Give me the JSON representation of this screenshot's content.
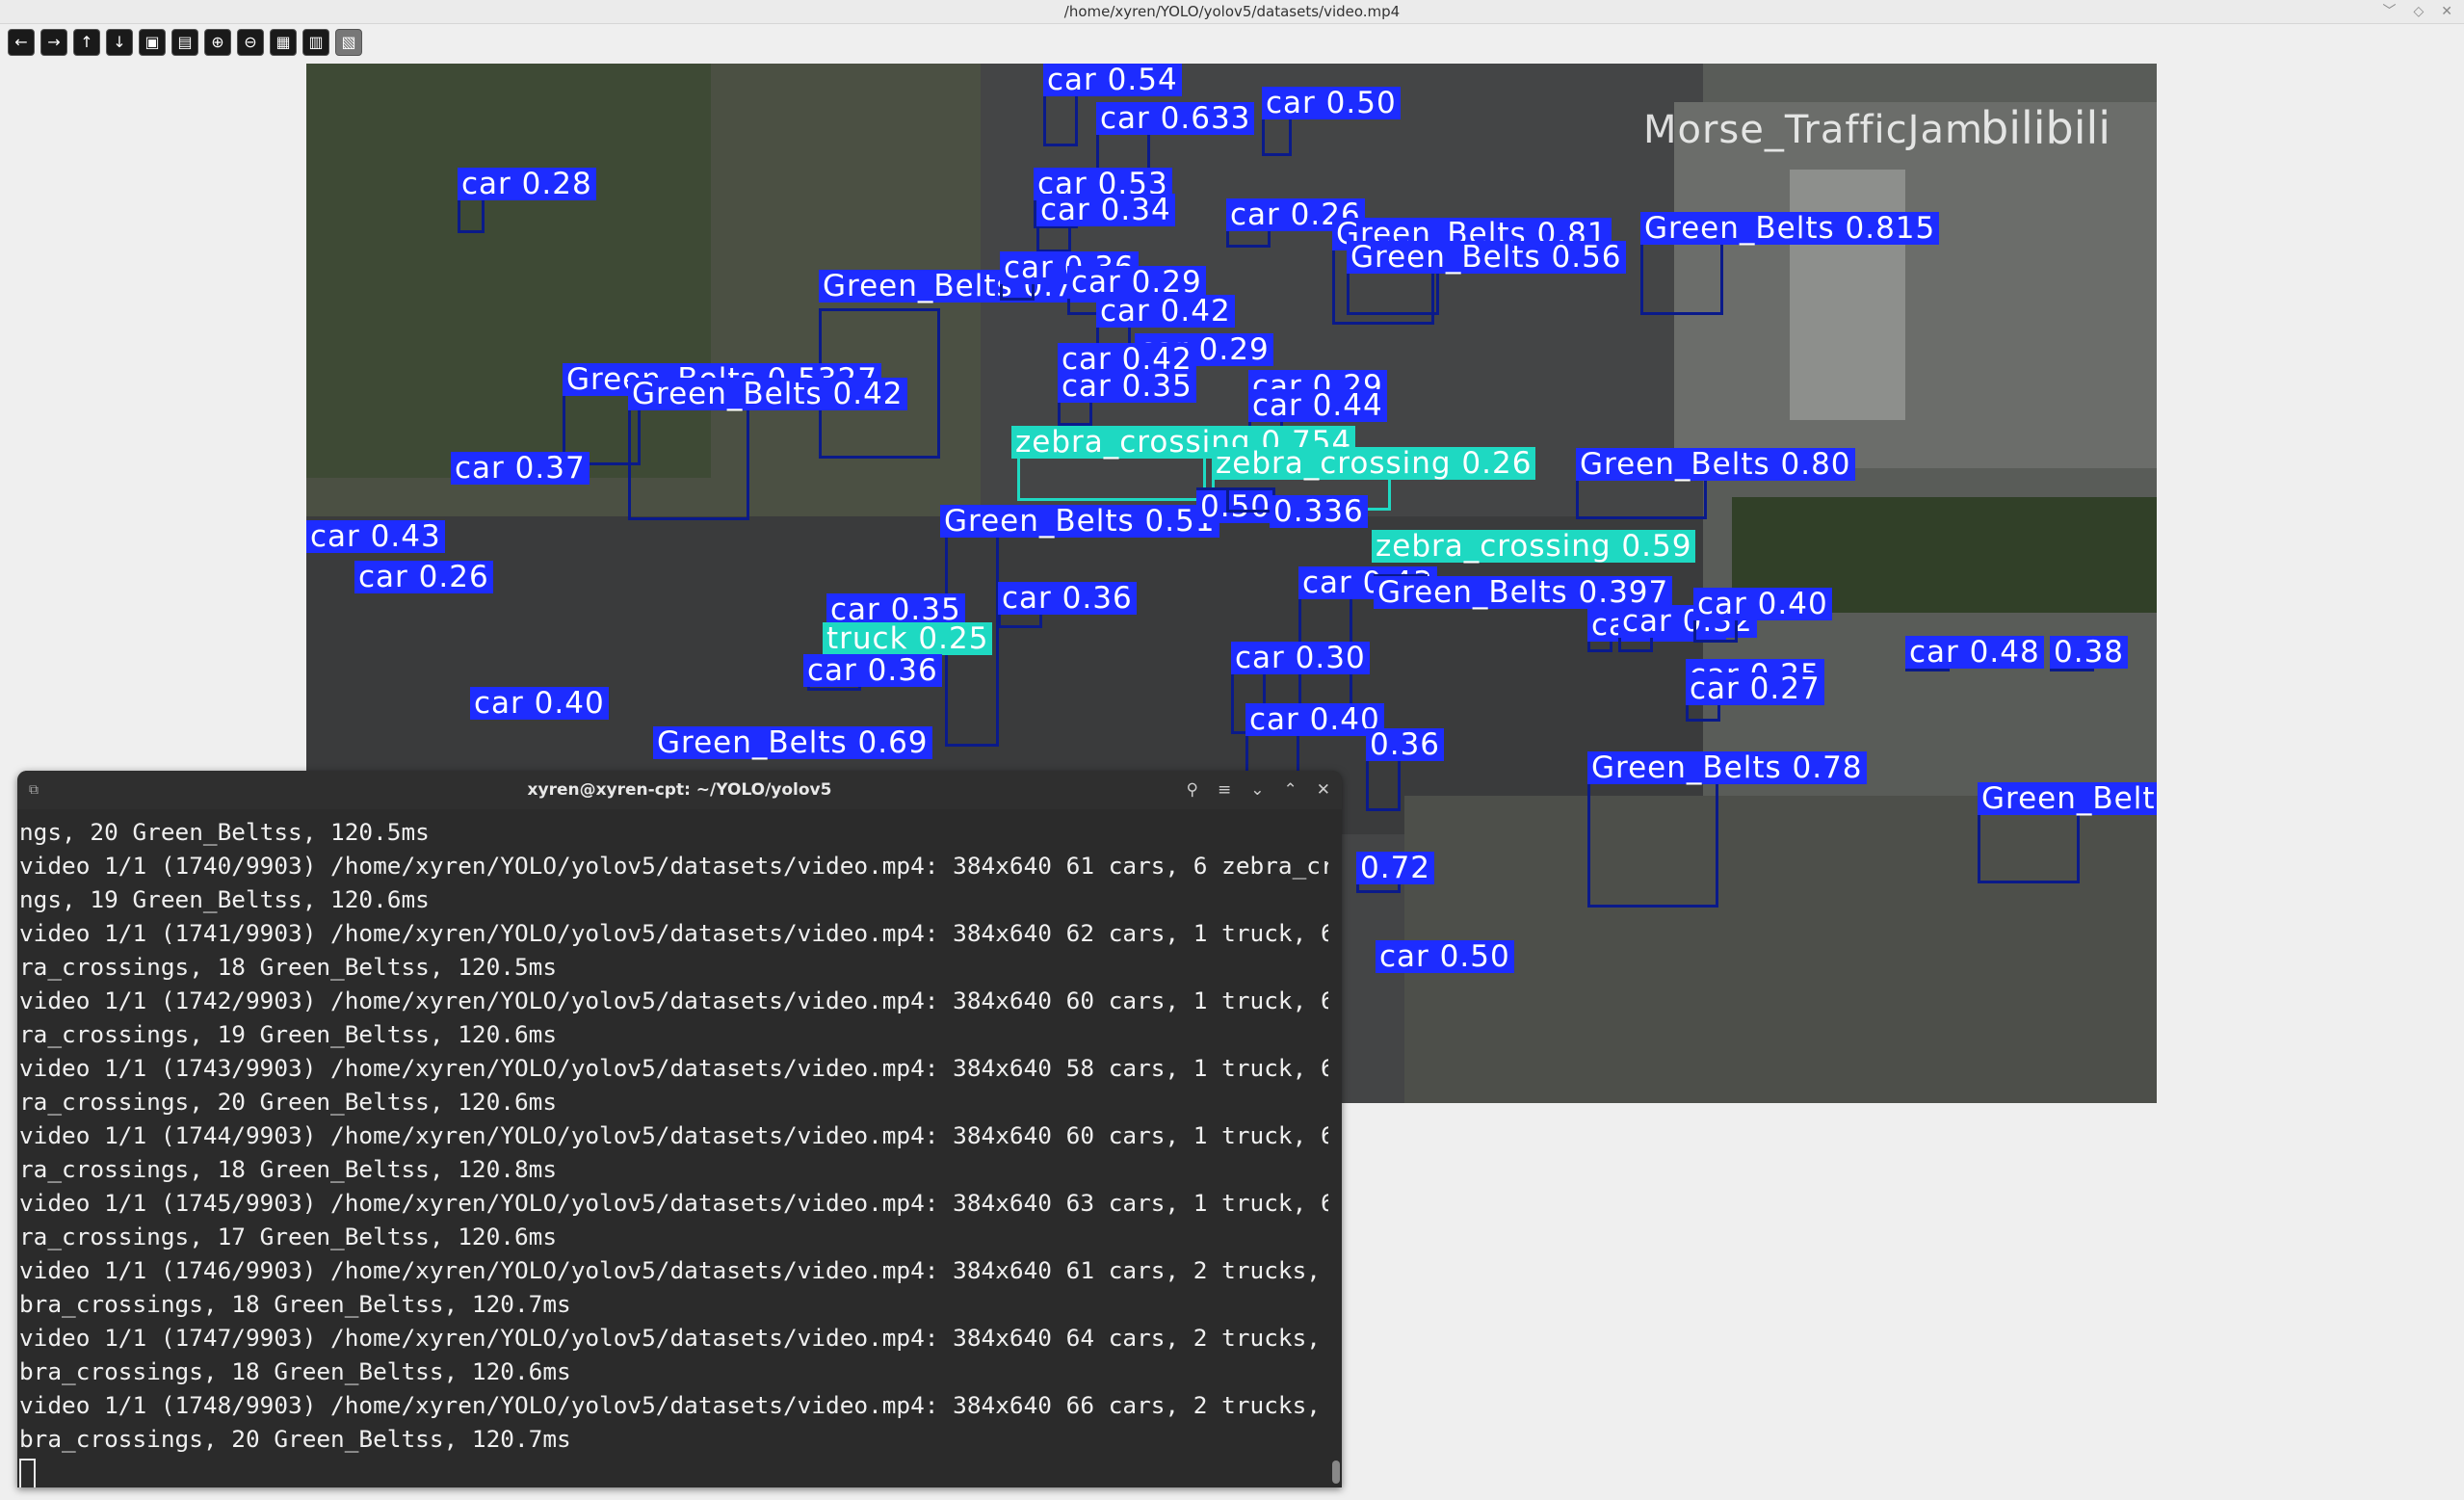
{
  "window": {
    "title": "/home/xyren/YOLO/yolov5/datasets/video.mp4",
    "controls": [
      "﹀",
      "◇",
      "✕"
    ]
  },
  "toolbar": {
    "icons": [
      "arrow-left-icon",
      "arrow-right-icon",
      "arrow-up-icon",
      "arrow-down-icon",
      "zoom-fit-icon",
      "zoom-100-icon",
      "zoom-in-icon",
      "zoom-out-icon",
      "save-icon",
      "properties-icon",
      "extra-icon"
    ]
  },
  "video": {
    "watermark": "Morse_TrafficJam",
    "watermark2": "bilibili",
    "detections": [
      {
        "label": "car 0.28",
        "type": "car"
      },
      {
        "label": "Green_Belts 0.76",
        "type": "belt"
      },
      {
        "label": "Green_Belts 0.5327",
        "type": "belt"
      },
      {
        "label": "Green_Belts 0.42",
        "type": "belt"
      },
      {
        "label": "car 0.37",
        "type": "car"
      },
      {
        "label": "car 0.43",
        "type": "car"
      },
      {
        "label": "car 0.26",
        "type": "car"
      },
      {
        "label": "car 0.40",
        "type": "car"
      },
      {
        "label": "Green_Belts 0.69",
        "type": "belt"
      },
      {
        "label": "car 0.54",
        "type": "car"
      },
      {
        "label": "car 0.633",
        "type": "car"
      },
      {
        "label": "car 0.53",
        "type": "car"
      },
      {
        "label": "car 0.34",
        "type": "car"
      },
      {
        "label": "car 0.36",
        "type": "car"
      },
      {
        "label": "car 0.29",
        "type": "car"
      },
      {
        "label": "car 0.42",
        "type": "car"
      },
      {
        "label": "car 0.29",
        "type": "car"
      },
      {
        "label": "car 0.42",
        "type": "car"
      },
      {
        "label": "car 0.35",
        "type": "car"
      },
      {
        "label": "car 0.26",
        "type": "car"
      },
      {
        "label": "car 0.50",
        "type": "car"
      },
      {
        "label": "car 0.29",
        "type": "car"
      },
      {
        "label": "car 0.44",
        "type": "car"
      },
      {
        "label": "zebra_crossing 0.754",
        "type": "zebra"
      },
      {
        "label": "zebra_crossing 0.26",
        "type": "zebra"
      },
      {
        "label": "Green_Belts 0.51",
        "type": "belt"
      },
      {
        "label": "0.50",
        "type": "car"
      },
      {
        "label": "0.336",
        "type": "car"
      },
      {
        "label": "car 0.35",
        "type": "car"
      },
      {
        "label": "truck 0.25",
        "type": "zebra"
      },
      {
        "label": "car 0.36",
        "type": "car"
      },
      {
        "label": "car 0.36",
        "type": "car"
      },
      {
        "label": "Green_Belts 0.81",
        "type": "belt"
      },
      {
        "label": "Green_Belts 0.56",
        "type": "belt"
      },
      {
        "label": "Green_Belts 0.815",
        "type": "belt"
      },
      {
        "label": "Green_Belts 0.80",
        "type": "belt"
      },
      {
        "label": "zebra_crossing 0.59",
        "type": "zebra"
      },
      {
        "label": "car 0.43",
        "type": "car"
      },
      {
        "label": "Green_Belts 0.397",
        "type": "belt"
      },
      {
        "label": "car 0.37",
        "type": "car"
      },
      {
        "label": "car 0.30",
        "type": "car"
      },
      {
        "label": "car 0.32",
        "type": "car"
      },
      {
        "label": "car 0.40",
        "type": "car"
      },
      {
        "label": "car 0.25",
        "type": "car"
      },
      {
        "label": "car 0.27",
        "type": "car"
      },
      {
        "label": "car 0.48",
        "type": "car"
      },
      {
        "label": "0.38",
        "type": "car"
      },
      {
        "label": "car 0.40",
        "type": "car"
      },
      {
        "label": "0.36",
        "type": "car"
      },
      {
        "label": "Green_Belts 0.78",
        "type": "belt"
      },
      {
        "label": "Green_Belts",
        "type": "belt"
      },
      {
        "label": "0.72",
        "type": "car"
      },
      {
        "label": "car 0.50",
        "type": "car"
      }
    ]
  },
  "terminal": {
    "title": "xyren@xyren-cpt: ~/YOLO/yolov5",
    "lines": [
      "ngs, 20 Green_Beltss, 120.5ms",
      "video 1/1 (1740/9903) /home/xyren/YOLO/yolov5/datasets/video.mp4: 384x640 61 cars, 6 zebra_crossi",
      "ngs, 19 Green_Beltss, 120.6ms",
      "video 1/1 (1741/9903) /home/xyren/YOLO/yolov5/datasets/video.mp4: 384x640 62 cars, 1 truck, 6 zeb",
      "ra_crossings, 18 Green_Beltss, 120.5ms",
      "video 1/1 (1742/9903) /home/xyren/YOLO/yolov5/datasets/video.mp4: 384x640 60 cars, 1 truck, 6 zeb",
      "ra_crossings, 19 Green_Beltss, 120.6ms",
      "video 1/1 (1743/9903) /home/xyren/YOLO/yolov5/datasets/video.mp4: 384x640 58 cars, 1 truck, 6 zeb",
      "ra_crossings, 20 Green_Beltss, 120.6ms",
      "video 1/1 (1744/9903) /home/xyren/YOLO/yolov5/datasets/video.mp4: 384x640 60 cars, 1 truck, 6 zeb",
      "ra_crossings, 18 Green_Beltss, 120.8ms",
      "video 1/1 (1745/9903) /home/xyren/YOLO/yolov5/datasets/video.mp4: 384x640 63 cars, 1 truck, 6 zeb",
      "ra_crossings, 17 Green_Beltss, 120.6ms",
      "video 1/1 (1746/9903) /home/xyren/YOLO/yolov5/datasets/video.mp4: 384x640 61 cars, 2 trucks, 6 ze",
      "bra_crossings, 18 Green_Beltss, 120.7ms",
      "video 1/1 (1747/9903) /home/xyren/YOLO/yolov5/datasets/video.mp4: 384x640 64 cars, 2 trucks, 7 ze",
      "bra_crossings, 18 Green_Beltss, 120.6ms",
      "video 1/1 (1748/9903) /home/xyren/YOLO/yolov5/datasets/video.mp4: 384x640 66 cars, 2 trucks, 7 ze",
      "bra_crossings, 20 Green_Beltss, 120.7ms"
    ]
  }
}
